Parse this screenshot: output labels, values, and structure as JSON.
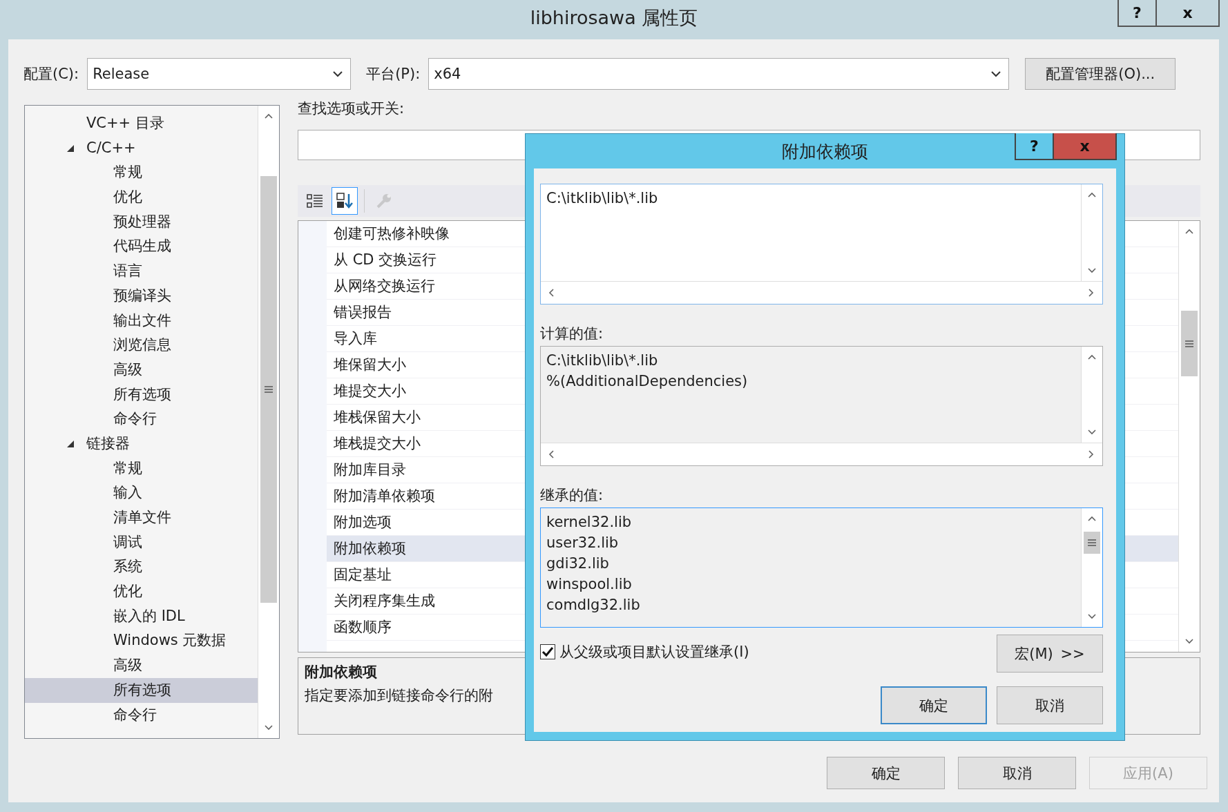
{
  "window": {
    "title": "libhirosawa 属性页",
    "buttons": [
      "?",
      "x"
    ]
  },
  "config": {
    "label": "配置(C):",
    "value": "Release"
  },
  "platform": {
    "label": "平台(P):",
    "value": "x64"
  },
  "config_manager_button": "配置管理器(O)...",
  "tree": [
    {
      "label": "VC++ 目录",
      "selected": false
    },
    {
      "label": "C/C++",
      "selected": false,
      "expanded": true,
      "children": [
        {
          "label": "常规",
          "selected": false
        },
        {
          "label": "优化",
          "selected": false
        },
        {
          "label": "预处理器",
          "selected": false
        },
        {
          "label": "代码生成",
          "selected": false
        },
        {
          "label": "语言",
          "selected": false
        },
        {
          "label": "预编译头",
          "selected": false
        },
        {
          "label": "输出文件",
          "selected": false
        },
        {
          "label": "浏览信息",
          "selected": false
        },
        {
          "label": "高级",
          "selected": false
        },
        {
          "label": "所有选项",
          "selected": false
        },
        {
          "label": "命令行",
          "selected": false
        }
      ]
    },
    {
      "label": "链接器",
      "selected": false,
      "expanded": true,
      "children": [
        {
          "label": "常规",
          "selected": false
        },
        {
          "label": "输入",
          "selected": false
        },
        {
          "label": "清单文件",
          "selected": false
        },
        {
          "label": "调试",
          "selected": false
        },
        {
          "label": "系统",
          "selected": false
        },
        {
          "label": "优化",
          "selected": false
        },
        {
          "label": "嵌入的 IDL",
          "selected": false
        },
        {
          "label": "Windows 元数据",
          "selected": false
        },
        {
          "label": "高级",
          "selected": false
        },
        {
          "label": "所有选项",
          "selected": true
        },
        {
          "label": "命令行",
          "selected": false
        }
      ]
    }
  ],
  "search": {
    "label": "查找选项或开关:"
  },
  "toolbar": [
    {
      "kind": "categorized",
      "selected": false,
      "disabled": false
    },
    {
      "kind": "alphabetical",
      "selected": true,
      "disabled": false
    },
    {
      "kind": "property_pages",
      "selected": false,
      "disabled": true
    }
  ],
  "property_rows": [
    {
      "label": "创建可热修补映像",
      "selected": false
    },
    {
      "label": "从 CD 交换运行",
      "selected": false
    },
    {
      "label": "从网络交换运行",
      "selected": false
    },
    {
      "label": "错误报告",
      "selected": false
    },
    {
      "label": "导入库",
      "selected": false
    },
    {
      "label": "堆保留大小",
      "selected": false
    },
    {
      "label": "堆提交大小",
      "selected": false
    },
    {
      "label": "堆栈保留大小",
      "selected": false
    },
    {
      "label": "堆栈提交大小",
      "selected": false
    },
    {
      "label": "附加库目录",
      "selected": false
    },
    {
      "label": "附加清单依赖项",
      "selected": false
    },
    {
      "label": "附加选项",
      "selected": false
    },
    {
      "label": "附加依赖项",
      "selected": true
    },
    {
      "label": "固定基址",
      "selected": false
    },
    {
      "label": "关闭程序集生成",
      "selected": false
    },
    {
      "label": "函数顺序",
      "selected": false
    }
  ],
  "description": {
    "title": "附加依赖项",
    "text": "指定要添加到链接命令行的附"
  },
  "buttons": [
    {
      "label": "确定",
      "disabled": false
    },
    {
      "label": "取消",
      "disabled": false
    },
    {
      "label": "应用(A)",
      "disabled": true
    }
  ],
  "dialog": {
    "title": "附加依赖项",
    "buttons": [
      "?",
      "x"
    ],
    "edit_lines": [
      "C:\\itklib\\lib\\*.lib"
    ],
    "computed_label": "计算的值:",
    "computed_lines": [
      "C:\\itklib\\lib\\*.lib",
      "%(AdditionalDependencies)"
    ],
    "inherited_label": "继承的值:",
    "inherited_lines": [
      "kernel32.lib",
      "user32.lib",
      "gdi32.lib",
      "winspool.lib",
      "comdlg32.lib"
    ],
    "inherit_checkbox": {
      "label": "从父级或项目默认设置继承(I)",
      "checked": true
    },
    "macro_button": "宏(M) >>",
    "ok_button": "确定",
    "cancel_button": "取消"
  }
}
